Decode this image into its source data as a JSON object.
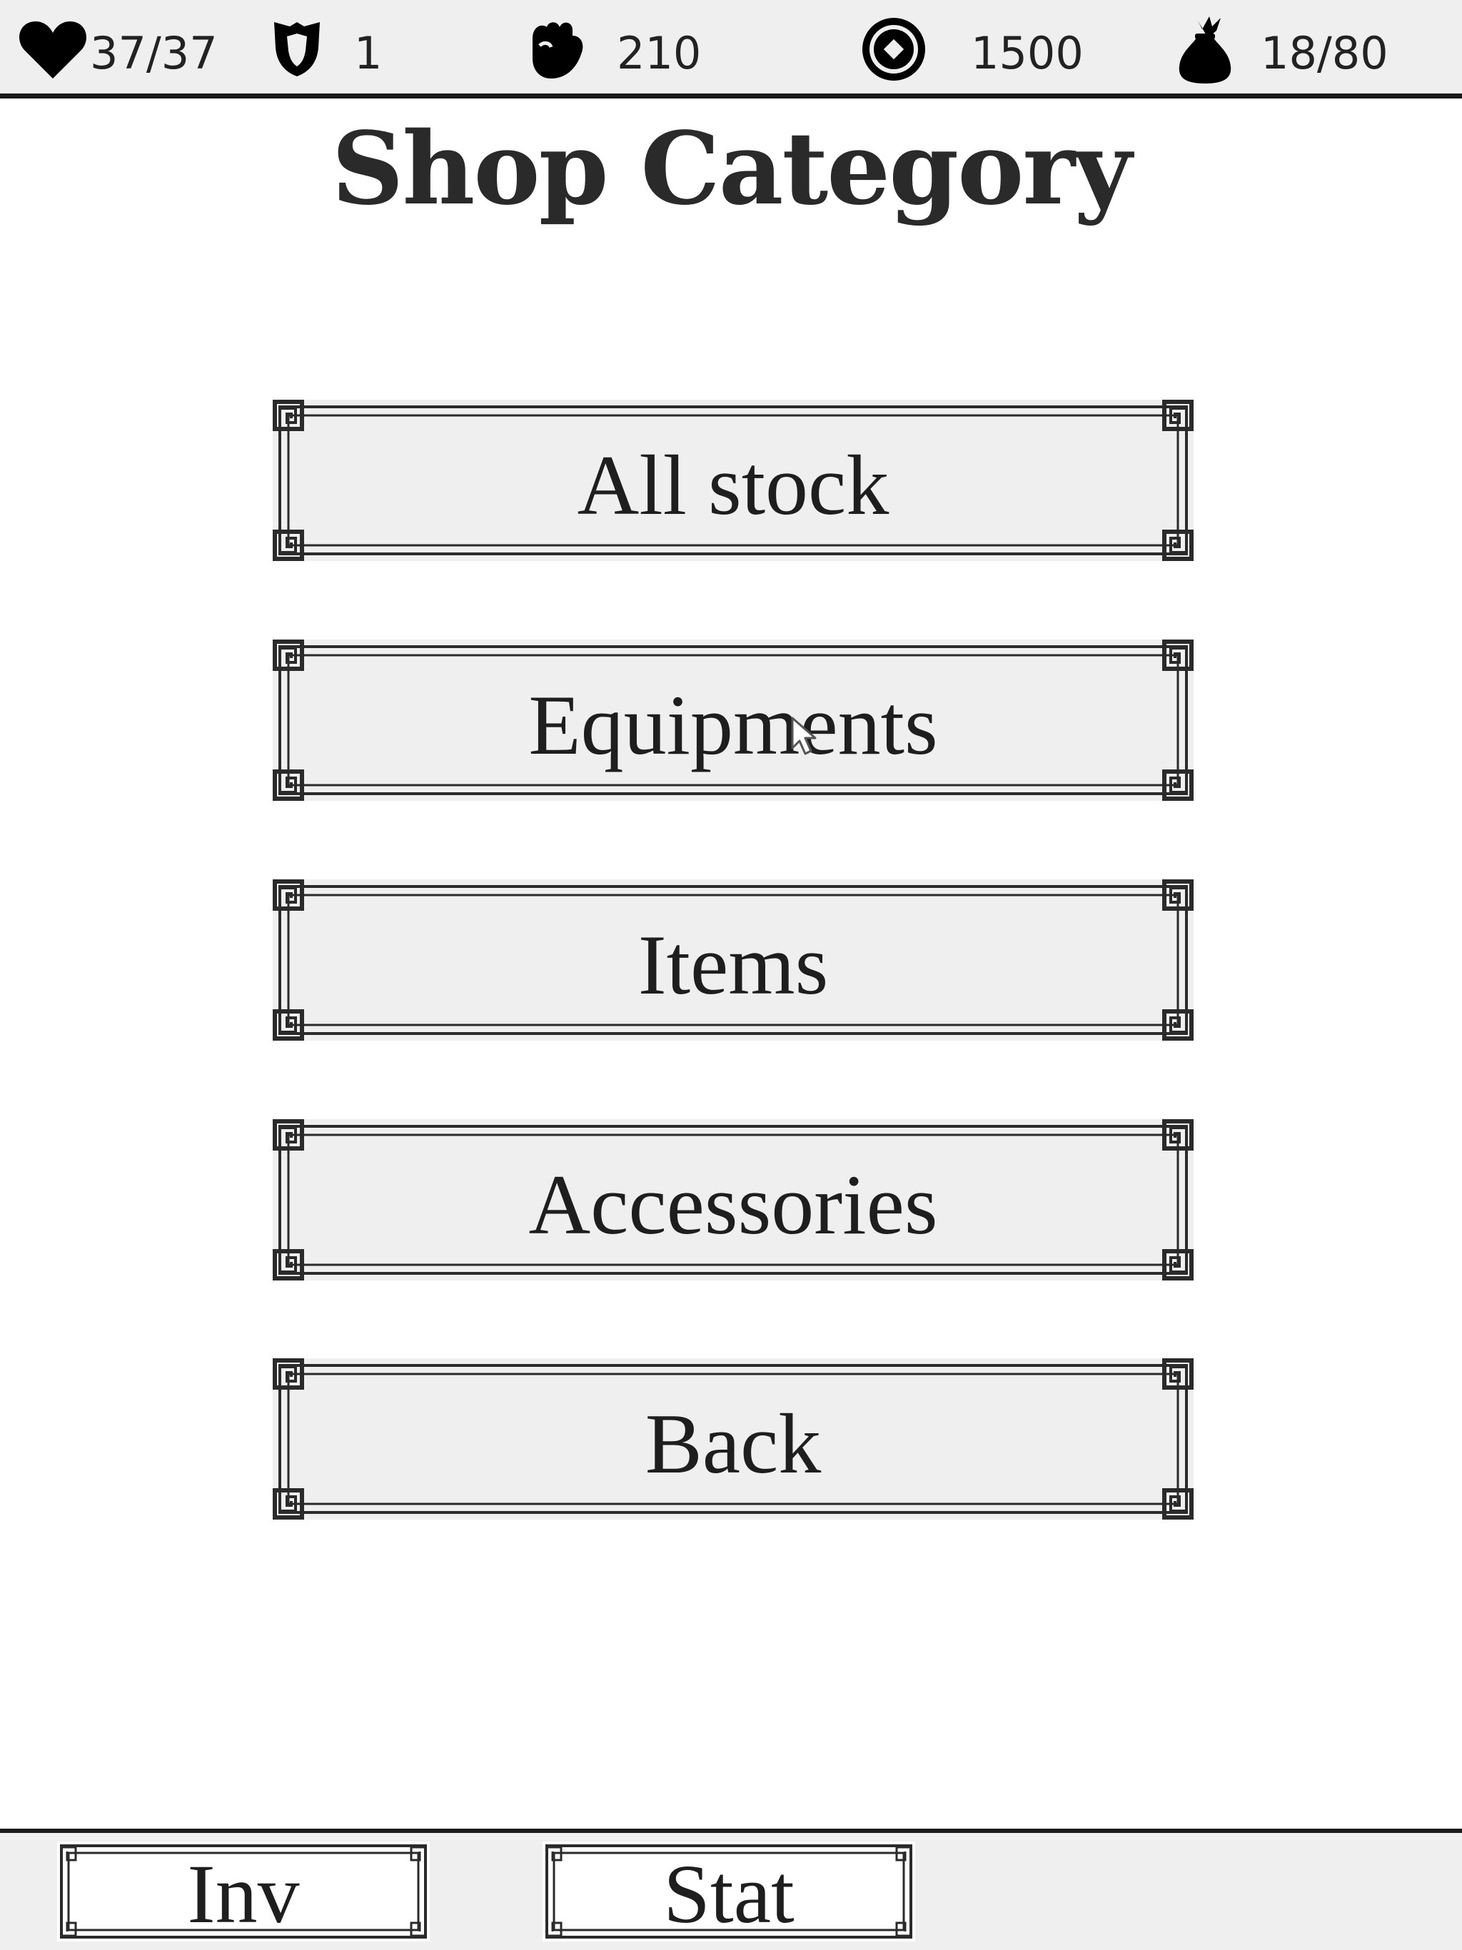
{
  "status_bar": {
    "hp": "37/37",
    "defense": "1",
    "attack": "210",
    "gold": "1500",
    "bag": "18/80"
  },
  "title": "Shop Category",
  "menu": {
    "all_stock": "All stock",
    "equipments": "Equipments",
    "items": "Items",
    "accessories": "Accessories",
    "back": "Back"
  },
  "bottom_bar": {
    "inv": "Inv",
    "stat": "Stat"
  },
  "icons": {
    "hp": "heart-icon",
    "defense": "shield-icon",
    "attack": "fist-icon",
    "gold": "coin-icon",
    "bag": "bag-icon"
  }
}
